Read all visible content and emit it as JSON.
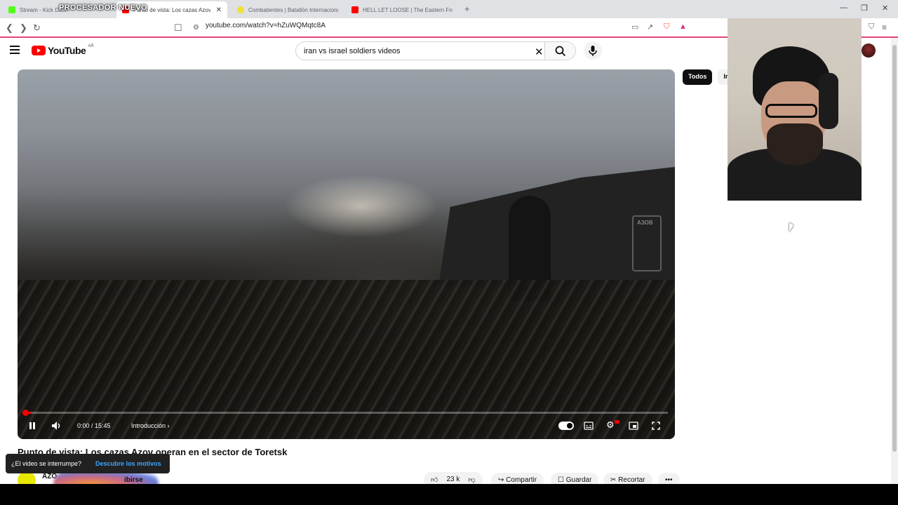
{
  "browser": {
    "overlay_text": "PROCESADOR NUEVO",
    "tabs": [
      {
        "title": "Stream - Kick Dash",
        "color": "#53fc18",
        "active": false
      },
      {
        "title": "Punto de vista: Los cazas Azov",
        "color": "#ff0000",
        "active": true
      },
      {
        "title": "Combatientes | Batallón Internacional",
        "color": "#f0e22e",
        "active": false
      },
      {
        "title": "HELL LET LOOSE | The Eastern Front",
        "color": "#ff0000",
        "active": false
      }
    ],
    "tab_close": "✕",
    "new_tab": "+",
    "url": "youtube.com/watch?v=hZuWQMqtc8A",
    "win_controls": [
      "—",
      "❐",
      "✕"
    ]
  },
  "youtube": {
    "logo_text": "YouTube",
    "region": "AR",
    "search_value": "iran vs israel soldiers videos",
    "filters": [
      "Todos",
      "Ir"
    ]
  },
  "player": {
    "progress": 0.01,
    "time": "0:00 / 15:45",
    "chapter": "Introducción",
    "watermark": "АЗОВ"
  },
  "video": {
    "title": "Punto de vista: Los cazas Azov operan en el sector de Toretsk",
    "channel_name": "AZO",
    "subscribe_label": "ibirse"
  },
  "popup": {
    "question": "¿El video se interrumpe?",
    "link": "Descubre los motivos"
  },
  "actions": {
    "likes": "23 k",
    "share": "Compartir",
    "save": "Guardar",
    "clip": "Recortar",
    "more": "•••"
  },
  "colors": {
    "accent": "#ff0000",
    "link": "#3ea6ff",
    "kick": "#53fc18"
  }
}
